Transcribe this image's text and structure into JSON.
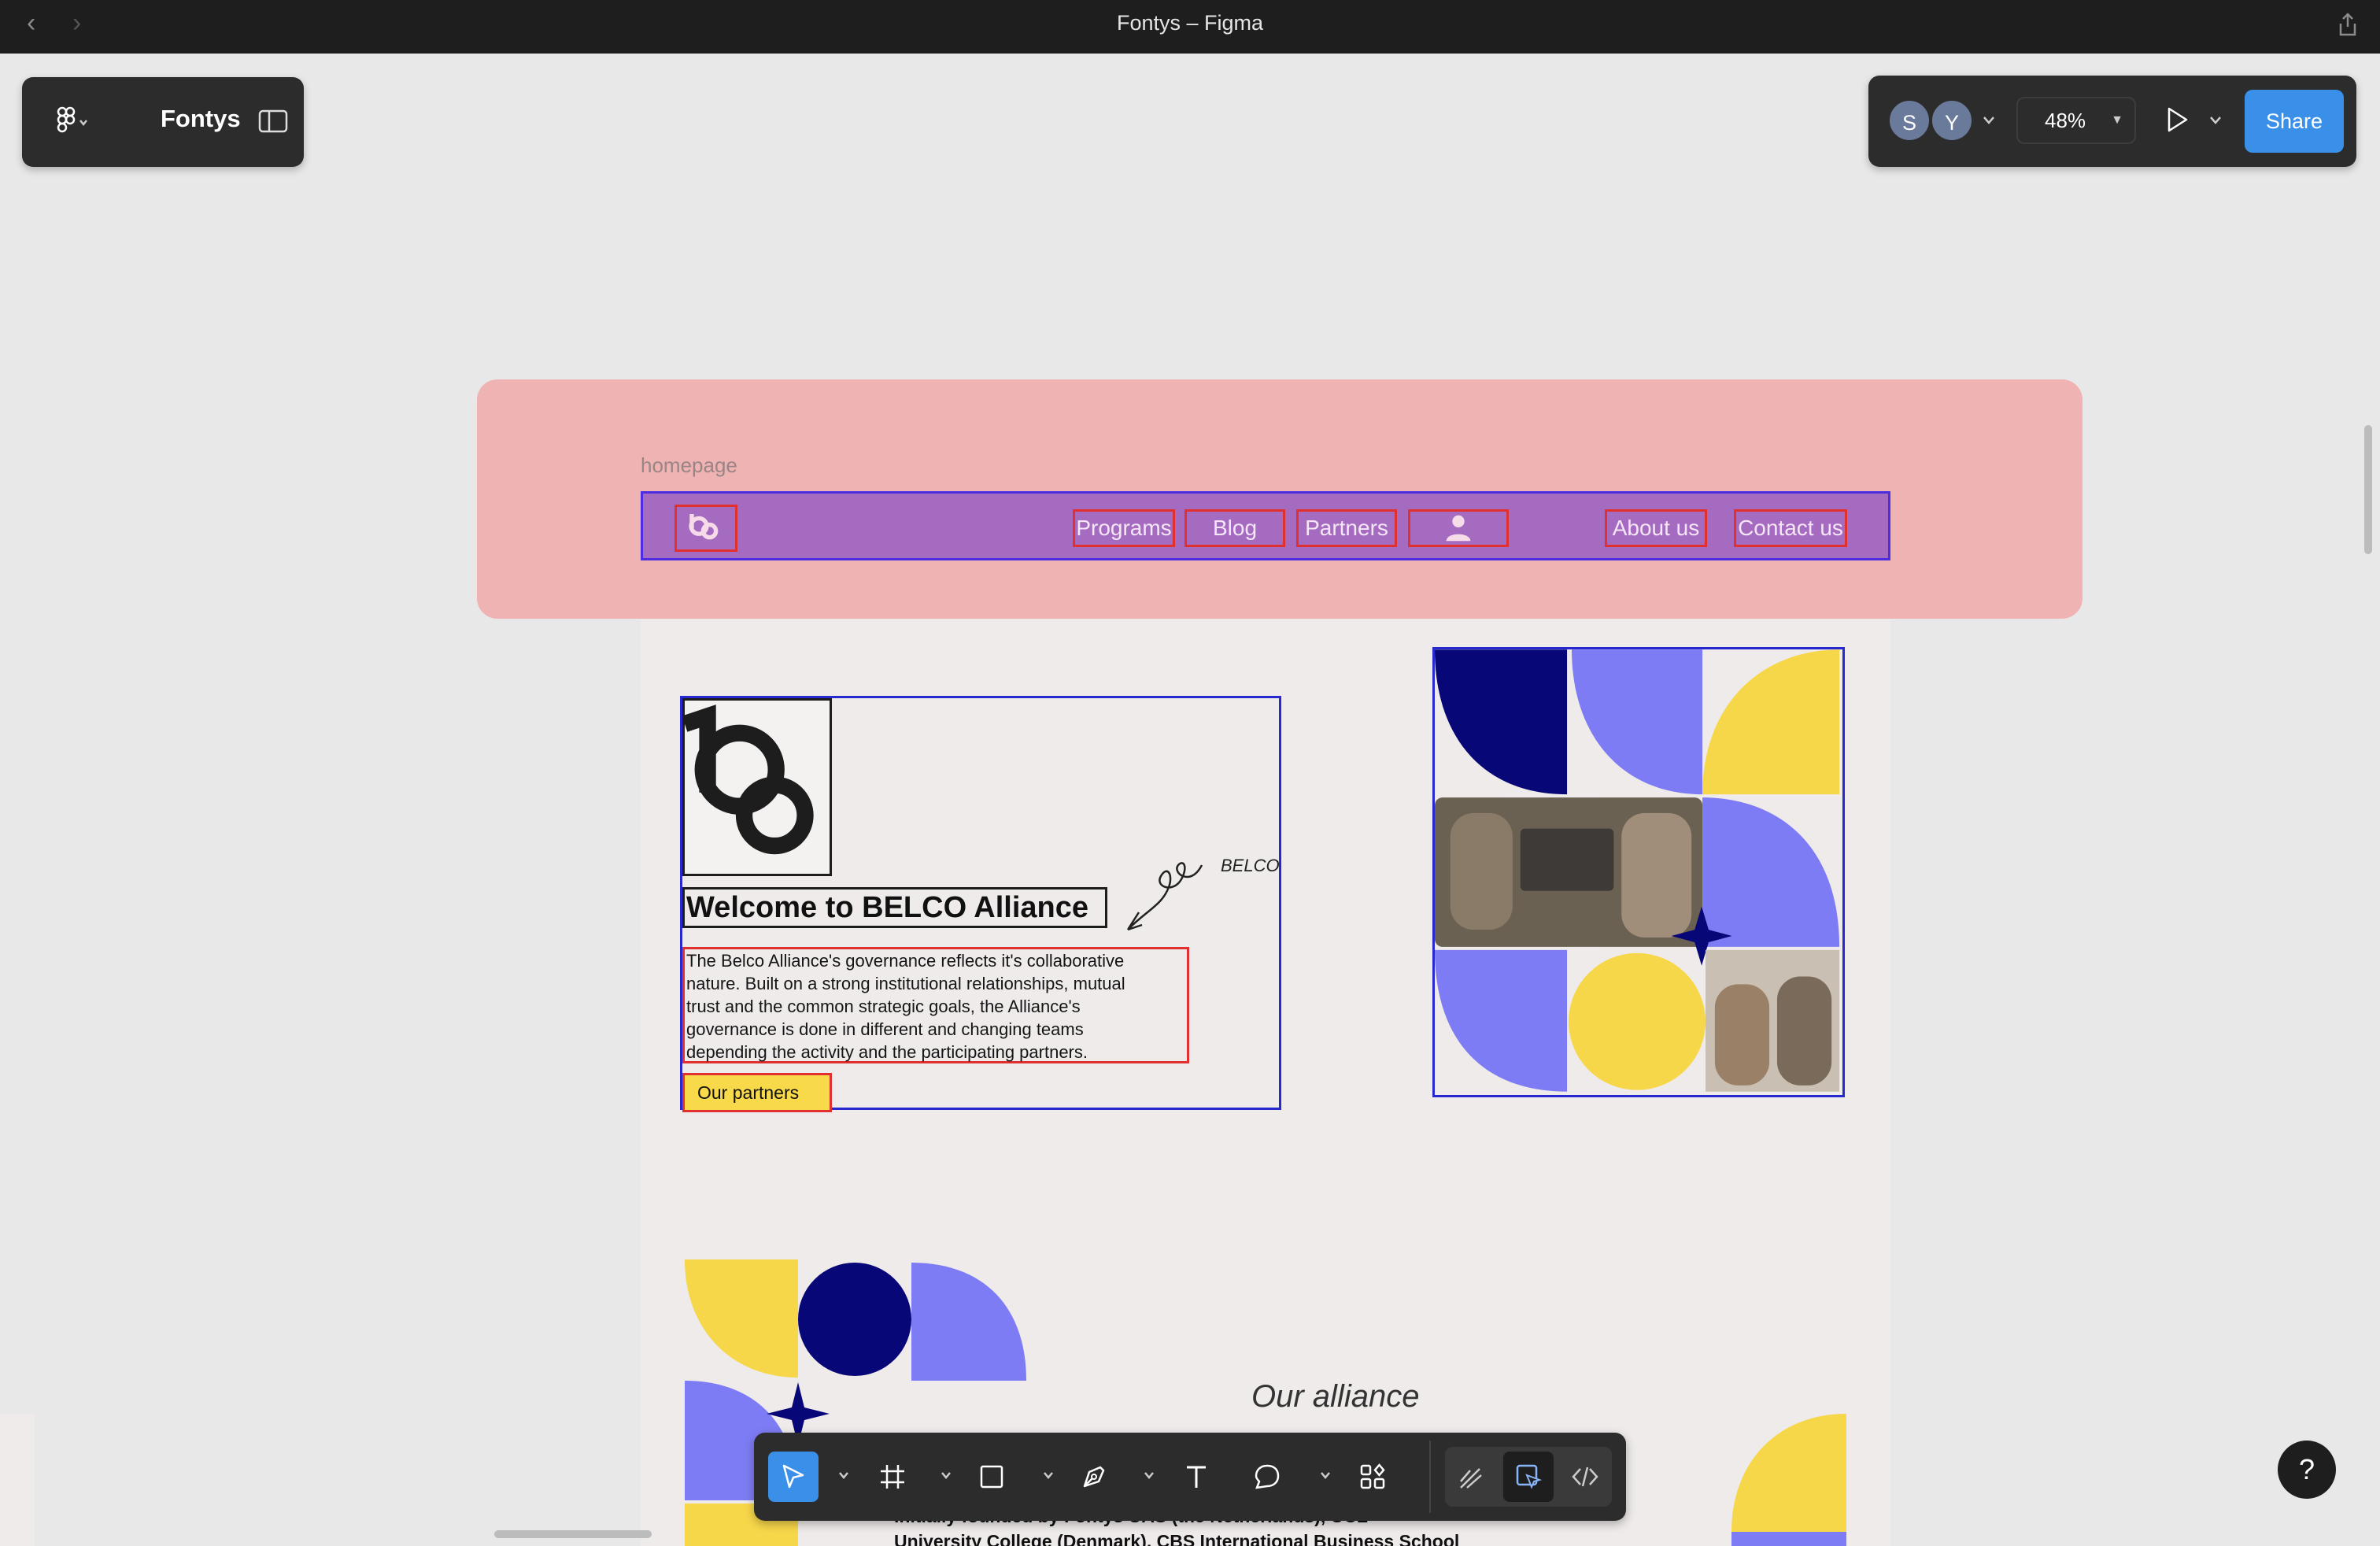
{
  "window": {
    "title": "Fontys – Figma"
  },
  "file": {
    "name": "Fontys"
  },
  "collaborators": [
    {
      "initial": "S",
      "color": "#6a7a9a"
    },
    {
      "initial": "Y",
      "color": "#6a7a9a"
    }
  ],
  "zoom": {
    "label": "48%"
  },
  "share": {
    "label": "Share"
  },
  "canvas": {
    "frame_label": "homepage",
    "nav": {
      "items": [
        "Programs",
        "Blog",
        "Partners",
        "About us",
        "Contact us"
      ]
    },
    "hero": {
      "title": "Welcome to BELCO Alliance",
      "body_lines": [
        "The Belco Alliance's governance reflects it's collaborative",
        "nature. Built on a strong institutional relationships, mutual",
        "trust and the common strategic goals, the Alliance's",
        "governance is done in different and changing teams",
        "depending the activity and the participating partners."
      ],
      "button": "Our partners",
      "signature_tag": "BELCO"
    },
    "alliance": {
      "title": "Our alliance",
      "text_lines": [
        "Initially founded by Fontys UAS (the Netherlands), UCL",
        "University College (Denmark), CBS International Business School"
      ]
    }
  },
  "help": {
    "label": "?"
  },
  "colors": {
    "navy": "#070777",
    "periwinkle": "#7e7cf4",
    "yellow": "#f7d74a",
    "accent": "#3a8fe8"
  }
}
